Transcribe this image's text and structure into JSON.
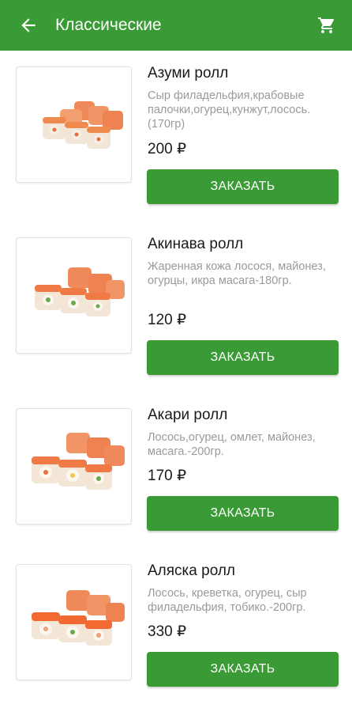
{
  "colors": {
    "primary": "#3a9a35",
    "name_text": "#1a1a1a",
    "desc_text": "#9a9a9a"
  },
  "header": {
    "title": "Классические",
    "back_icon": "arrow-left-icon",
    "cart_icon": "shopping-cart-icon"
  },
  "products": [
    {
      "name": "Азуми ролл",
      "description": "Сыр филадельфия,крабовые палочки,огурец,кунжут,лосось.(170гр)",
      "price": "200 ₽",
      "button": "ЗАКАЗАТЬ",
      "image": "sushi-roll-image"
    },
    {
      "name": "Акинава ролл",
      "description": "Жаренная кожа лосося, майонез, огурцы, икра масага-180гр.",
      "price": "120 ₽",
      "button": "ЗАКАЗАТЬ",
      "image": "sushi-roll-image"
    },
    {
      "name": "Акари ролл",
      "description": "Лосось,огурец, омлет, майонез, масага.-200гр.",
      "price": "170 ₽",
      "button": "ЗАКАЗАТЬ",
      "image": "sushi-roll-image"
    },
    {
      "name": "Аляска ролл",
      "description": "Лосось, креветка, огурец, сыр филадельфия, тобико.-200гр.",
      "price": "330 ₽",
      "button": "ЗАКАЗАТЬ",
      "image": "sushi-roll-image"
    }
  ]
}
